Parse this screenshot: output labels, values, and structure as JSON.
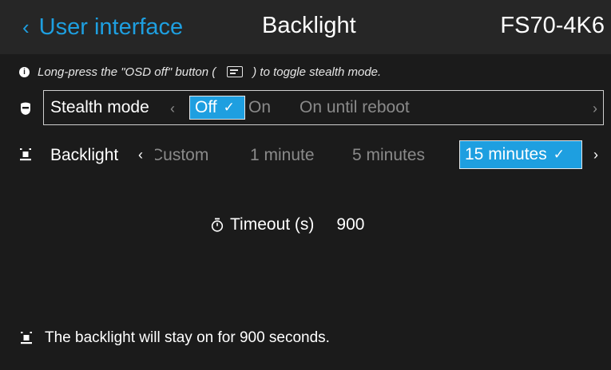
{
  "header": {
    "back_label": "User interface",
    "title": "Backlight",
    "model": "FS70-4K6"
  },
  "info": {
    "text_before": "Long-press the \"OSD off\" button (",
    "text_after": ") to toggle stealth mode."
  },
  "stealth": {
    "label": "Stealth mode",
    "options": [
      "Off",
      "On",
      "On until reboot"
    ],
    "selected": "Off"
  },
  "backlight": {
    "label": "Backlight",
    "options": [
      "Custom",
      "1 minute",
      "5 minutes",
      "15 minutes"
    ],
    "selected": "15 minutes"
  },
  "timeout": {
    "label": "Timeout (s)",
    "value": "900"
  },
  "footer": {
    "text": "The backlight will stay on for 900 seconds."
  },
  "colors": {
    "accent": "#1e9fe0",
    "background": "#1b1b1b",
    "header": "#262626",
    "dim_text": "#8a8a8a"
  },
  "icons": [
    "chevron-left-icon",
    "info-icon",
    "osd-button-icon",
    "stealth-mask-icon",
    "backlight-icon",
    "check-icon",
    "chevron-right-icon",
    "timer-icon"
  ]
}
